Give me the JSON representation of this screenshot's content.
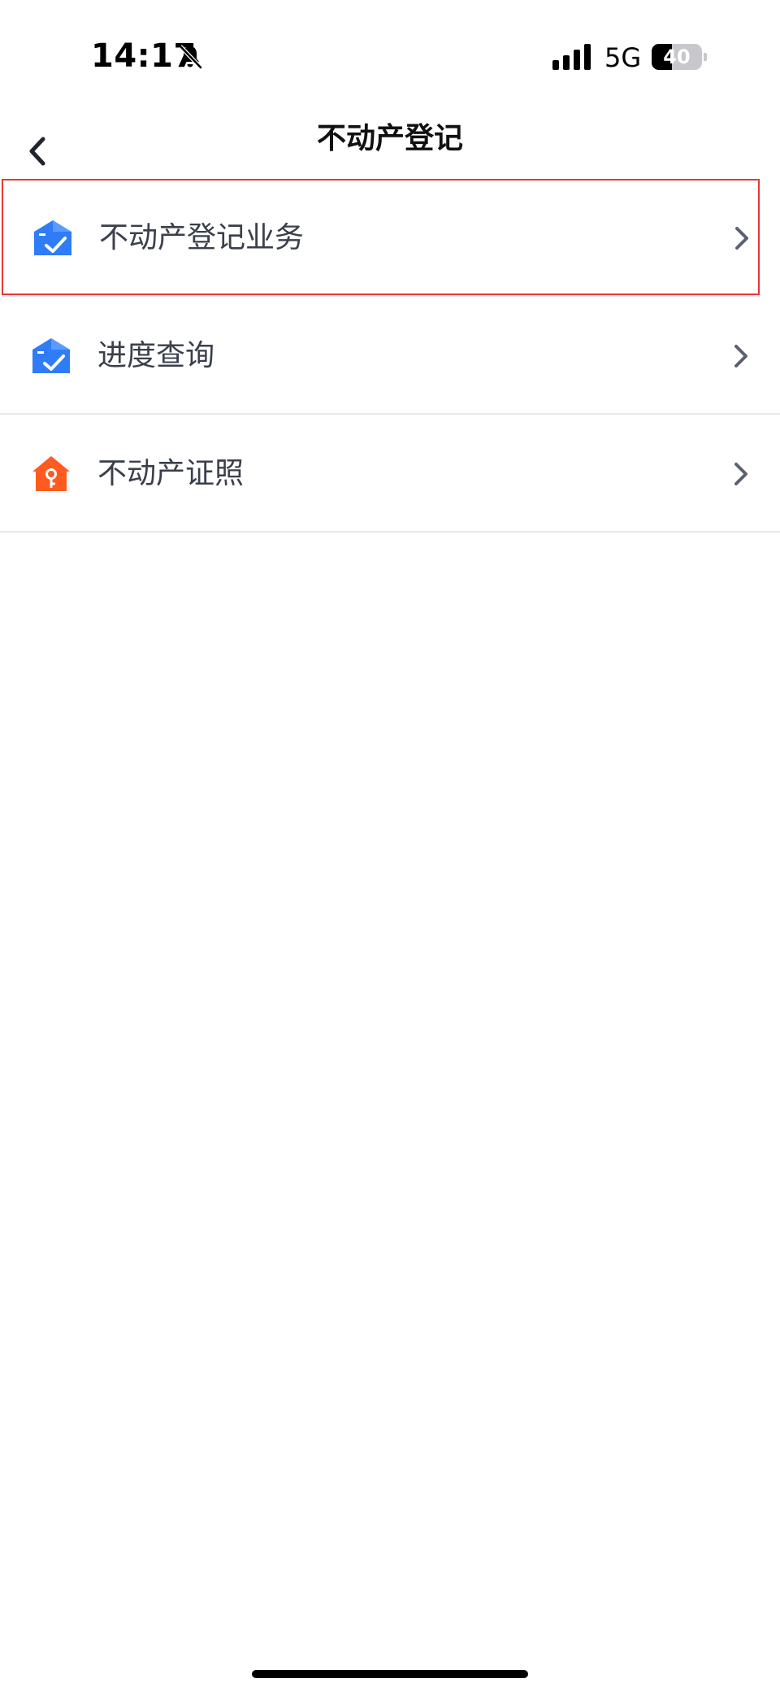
{
  "status_bar": {
    "time": "14:17",
    "network": "5G",
    "battery_level": "40",
    "battery_fraction": 0.4,
    "icons": [
      "bell-slash-icon",
      "cellular-signal-icon",
      "battery-icon"
    ]
  },
  "nav": {
    "title": "不动产登记",
    "back_icon": "chevron-left-icon"
  },
  "menu": [
    {
      "label": "不动产登记业务",
      "icon": "house-check-icon",
      "icon_color": "#2f7cf6",
      "selected": true
    },
    {
      "label": "进度查询",
      "icon": "house-check-icon",
      "icon_color": "#2f7cf6",
      "selected": false
    },
    {
      "label": "不动产证照",
      "icon": "house-key-icon",
      "icon_color": "#ff5a1f",
      "selected": false
    }
  ],
  "colors": {
    "selection_border": "#e53935",
    "divider": "#e8e8ec",
    "chevron": "#5a6170"
  }
}
